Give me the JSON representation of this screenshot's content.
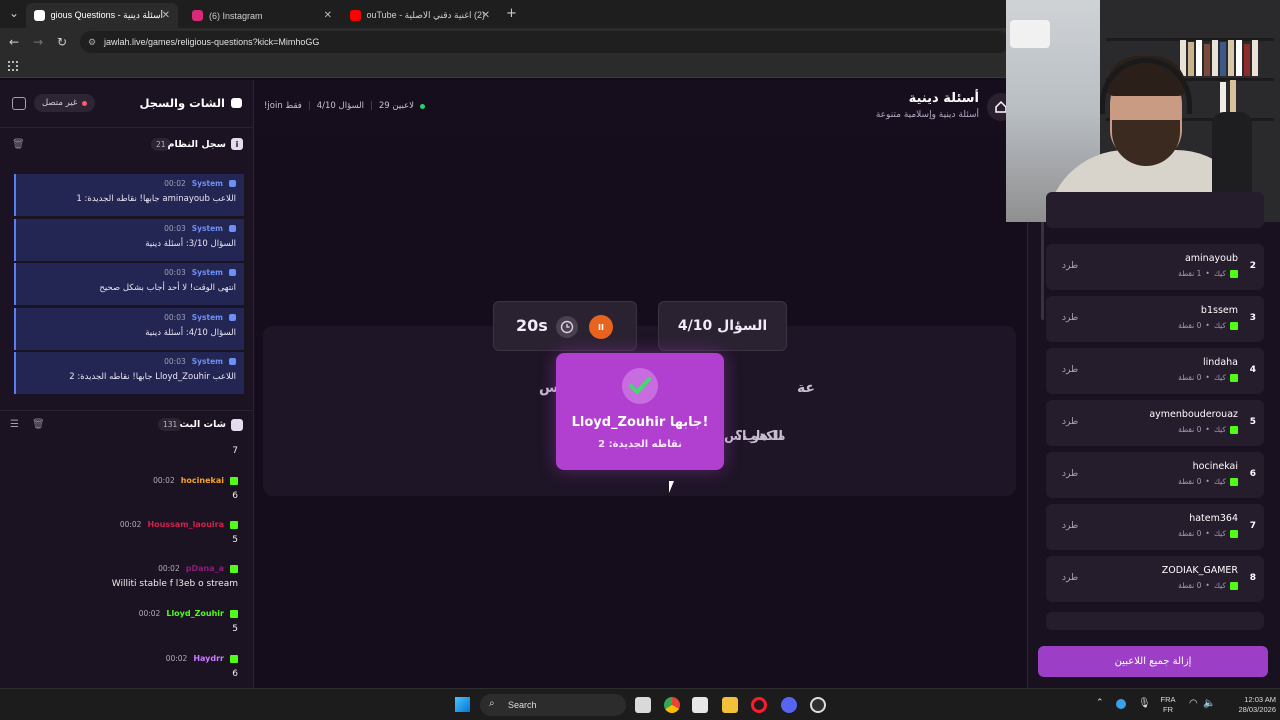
{
  "browser": {
    "tabs": [
      {
        "label": "أسئلة دينية - Religious Questions",
        "active": true
      },
      {
        "label": "(6) Instagram",
        "active": false
      },
      {
        "label": "(2) اغنية دقني الاصلية - YouTube",
        "active": false
      }
    ],
    "url": "jawlah.live/games/religious-questions?kick=MimhoGG"
  },
  "header": {
    "title": "أسئلة دينية",
    "subtitle": "أسئلة دينية وإسلامية متنوعة",
    "players": "29 لاعبين",
    "question": "السؤال 4/10",
    "join": "!join فقط"
  },
  "left": {
    "title": "الشات والسجل",
    "status": "غير متصل",
    "system_log": {
      "title": "سجل النظام",
      "count": "21"
    },
    "system_messages": [
      {
        "name": "System",
        "time": "00:02",
        "text": "اللاعب aminayoub جابها! نقاطه الجديدة: 1"
      },
      {
        "name": "System",
        "time": "00:03",
        "text": "السؤال 3/10: أسئلة دينية"
      },
      {
        "name": "System",
        "time": "00:03",
        "text": "انتهى الوقت! لا أحد أجاب بشكل صحيح"
      },
      {
        "name": "System",
        "time": "00:03",
        "text": "السؤال 4/10: أسئلة دينية"
      },
      {
        "name": "System",
        "time": "00:03",
        "text": "اللاعب Lloyd_Zouhir جابها! نقاطه الجديدة: 2"
      }
    ],
    "stream_chat": {
      "title": "شات البث",
      "count": "131"
    },
    "chat": [
      {
        "user": "",
        "time": "",
        "msg": "7",
        "color": "#ffffff"
      },
      {
        "user": "hocinekai",
        "time": "00:02",
        "msg": "6",
        "color": "#f5a524"
      },
      {
        "user": "Houssam_laouira",
        "time": "00:02",
        "msg": "5",
        "color": "#d6204c"
      },
      {
        "user": "pDana_a",
        "time": "00:02",
        "msg": "Williti stable f l3eb o stream",
        "color": "#8e1c7a"
      },
      {
        "user": "Lloyd_Zouhir",
        "time": "00:02",
        "msg": "5",
        "color": "#53fc18"
      },
      {
        "user": "Haydrr",
        "time": "00:02",
        "msg": "6",
        "color": "#c77dff"
      }
    ]
  },
  "center": {
    "question_num": "السؤال 4/10",
    "timer": "20s",
    "pause": "II",
    "category": "أسئلة دينية متنوعة",
    "category_left": "أس",
    "category_right": "عة",
    "question_text": "ما هو اسم ... الكتاب؟",
    "question_right": "ما هو اس",
    "question_left": "الكتاب؟",
    "popup_title": "Lloyd_Zouhir جابها!",
    "popup_sub": "نقاطه الجديدة: 2"
  },
  "right": {
    "players": [
      {
        "rank": "2",
        "name": "aminayoub",
        "points": "1 نقطة",
        "platform": "كيك",
        "kick": "طرد"
      },
      {
        "rank": "3",
        "name": "b1ssem",
        "points": "0 نقطة",
        "platform": "كيك",
        "kick": "طرد"
      },
      {
        "rank": "4",
        "name": "lindaha",
        "points": "0 نقطة",
        "platform": "كيك",
        "kick": "طرد"
      },
      {
        "rank": "5",
        "name": "aymenbouderouaz",
        "points": "0 نقطة",
        "platform": "كيك",
        "kick": "طرد"
      },
      {
        "rank": "6",
        "name": "hocinekai",
        "points": "0 نقطة",
        "platform": "كيك",
        "kick": "طرد"
      },
      {
        "rank": "7",
        "name": "hatem364",
        "points": "0 نقطة",
        "platform": "كيك",
        "kick": "طرد"
      },
      {
        "rank": "8",
        "name": "ZODIAK_GAMER",
        "points": "0 نقطة",
        "platform": "كيك",
        "kick": "طرد"
      }
    ],
    "remove_all": "إزالة جميع اللاعبين"
  },
  "taskbar": {
    "search": "Search",
    "lang_top": "FRA",
    "lang_bottom": "FR",
    "time": "12:03 AM",
    "date": "28/03/2026"
  },
  "colors": {
    "accent": "#9c3fc6",
    "kick_green": "#53fc18",
    "system_blue": "#6e8ff7"
  }
}
